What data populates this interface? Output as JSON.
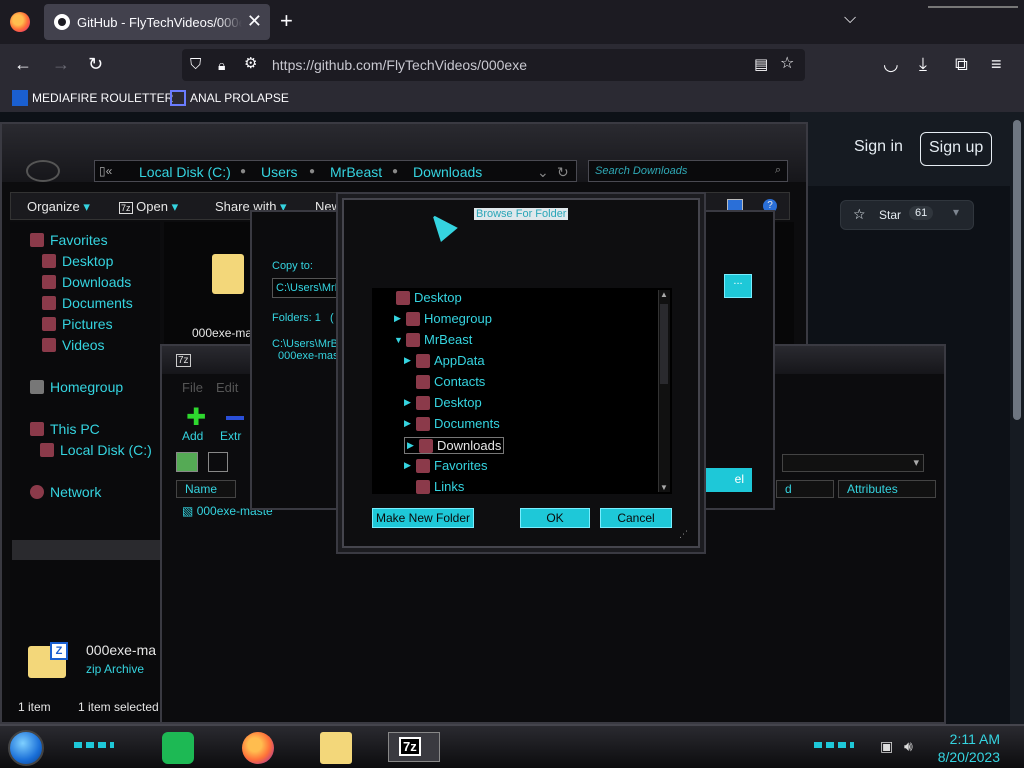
{
  "browser": {
    "tab_title": "GitHub - FlyTechVideos/000exe",
    "url_host": "github.com",
    "url_full": "https://github.com/FlyTechVideos/000exe",
    "bookmarks": [
      "MEDIAFIRE ROULETTER",
      "ANAL PROLAPSE"
    ]
  },
  "github": {
    "sign_in": "Sign in",
    "sign_up": "Sign up",
    "star_label": "Star",
    "star_count": "61"
  },
  "explorer": {
    "breadcrumbs": [
      "Local Disk (C:)",
      "Users",
      "MrBeast",
      "Downloads"
    ],
    "search_placeholder": "Search Downloads",
    "commands": [
      "Organize",
      "Open",
      "Share with",
      "New"
    ],
    "nav": {
      "favorites": "Favorites",
      "fav_items": [
        "Desktop",
        "Downloads",
        "Documents",
        "Pictures",
        "Videos"
      ],
      "homegroup": "Homegroup",
      "this_pc": "This PC",
      "local_disk": "Local Disk (C:)",
      "network": "Network"
    },
    "file_name": "000exe-ma",
    "details_name": "000exe-ma",
    "details_type": "zip Archive",
    "status_count": "1 item",
    "status_selected": "1 item selected"
  },
  "sevenzip": {
    "title_icon": "7z",
    "menu": [
      "File",
      "Edit"
    ],
    "toolbar": [
      "Add",
      "Extr"
    ],
    "columns": [
      "Name",
      "d",
      "Attributes"
    ],
    "file_row": "000exe-maste"
  },
  "copy_dialog": {
    "copy_to_label": "Copy to:",
    "path_value": "C:\\Users\\MrB",
    "folders_label": "Folders: 1",
    "folders_paren": "(",
    "source_line1": "C:\\Users\\MrBe",
    "source_line2": "000exe-mast",
    "browse_label": "...",
    "cancel_label": "el"
  },
  "browse_dialog": {
    "title": "Browse For Folder",
    "tree": [
      {
        "label": "Desktop",
        "level": 0,
        "arrow": ""
      },
      {
        "label": "Homegroup",
        "level": 1,
        "arrow": "▶"
      },
      {
        "label": "MrBeast",
        "level": 1,
        "arrow": "▼"
      },
      {
        "label": "AppData",
        "level": 2,
        "arrow": "▶"
      },
      {
        "label": "Contacts",
        "level": 2,
        "arrow": ""
      },
      {
        "label": "Desktop",
        "level": 2,
        "arrow": "▶"
      },
      {
        "label": "Documents",
        "level": 2,
        "arrow": "▶"
      },
      {
        "label": "Downloads",
        "level": 2,
        "arrow": "▶",
        "selected": true
      },
      {
        "label": "Favorites",
        "level": 2,
        "arrow": "▶"
      },
      {
        "label": "Links",
        "level": 2,
        "arrow": ""
      }
    ],
    "new_folder": "Make New Folder",
    "ok": "OK",
    "cancel": "Cancel"
  },
  "taskbar": {
    "apps": [
      "notes-app",
      "firefox",
      "file-explorer",
      "7z"
    ],
    "app_7z_label": "7z",
    "time": "2:11 AM",
    "date": "8/20/2023"
  },
  "colors": {
    "accent_cyan": "#35d4e0",
    "button_cyan": "#1ec8d8",
    "github_bg": "#0d1117"
  }
}
